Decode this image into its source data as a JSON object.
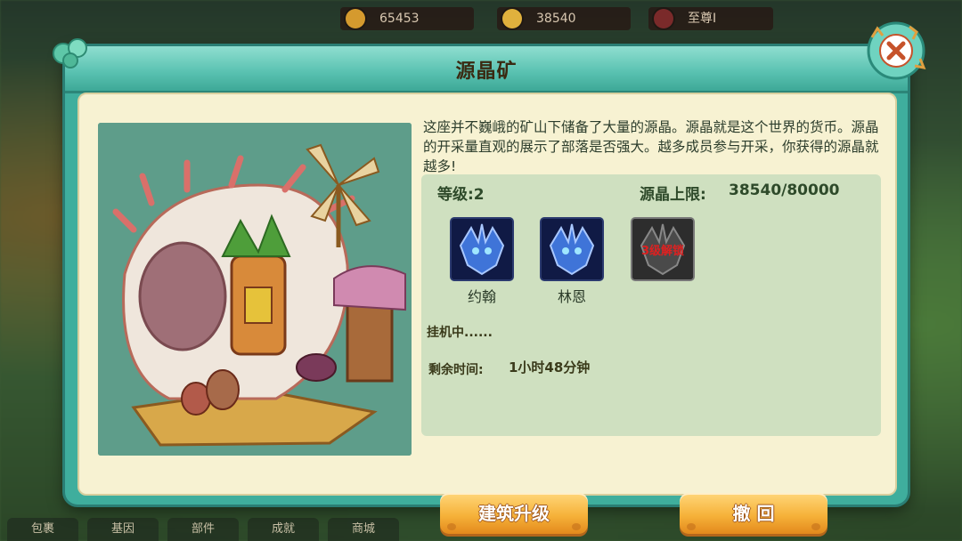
{
  "hud": {
    "resources": [
      {
        "value": "65453",
        "icon": "wood-icon"
      },
      {
        "value": "38540",
        "icon": "crystal-icon"
      },
      {
        "value": "至尊I",
        "icon": "rank-icon"
      }
    ],
    "bottom_tabs": [
      "包裹",
      "基因",
      "部件",
      "成就",
      "商城"
    ]
  },
  "dialog": {
    "title": "源晶矿",
    "description": "这座并不巍峨的矿山下储备了大量的源晶。源晶就是这个世界的货币。源晶的开采量直观的展示了部落是否强大。越多成员参与开采，你获得的源晶就越多!",
    "level_text": "等级:2",
    "capacity_label": "源晶上限:",
    "capacity_value": "38540/80000",
    "workers": [
      {
        "name": "约翰",
        "locked": false
      },
      {
        "name": "林恩",
        "locked": false
      },
      {
        "name": "",
        "locked": true,
        "lock_text": "3级解锁"
      }
    ],
    "status_text": "挂机中......",
    "remaining_label": "剩余时间:",
    "remaining_value": "1小时48分钟",
    "upgrade_button": "建筑升级",
    "withdraw_button": "撤 回"
  },
  "colors": {
    "frame": "#3fae9d",
    "panel": "#f7f2d2",
    "info_bg": "#cfe0c0",
    "button": "#f6b23a"
  }
}
